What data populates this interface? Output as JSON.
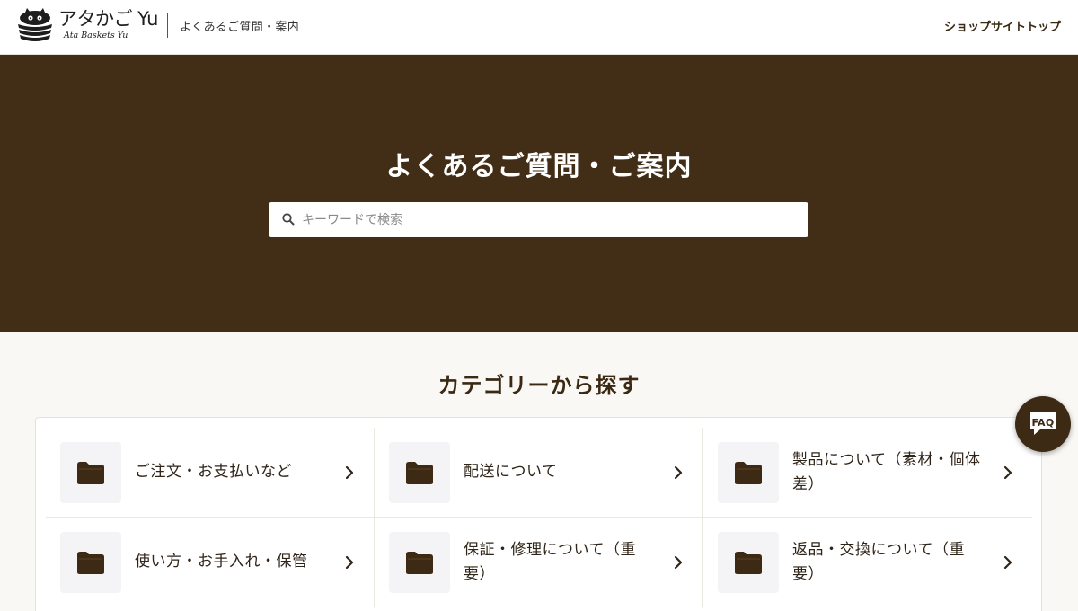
{
  "header": {
    "logo_main": "アタかご Yu",
    "logo_sub": "Ata Baskets Yu",
    "page_title": "よくあるご質問・案内",
    "shop_link": "ショップサイトトップ"
  },
  "hero": {
    "title": "よくあるご質問・ご案内",
    "search_placeholder": "キーワードで検索"
  },
  "categories": {
    "title": "カテゴリーから探す",
    "items": [
      {
        "label": "ご注文・お支払いなど",
        "icon": "folder-icon"
      },
      {
        "label": "配送について",
        "icon": "folder-icon"
      },
      {
        "label": "製品について（素材・個体差）",
        "icon": "folder-icon"
      },
      {
        "label": "使い方・お手入れ・保管",
        "icon": "folder-icon"
      },
      {
        "label": "保証・修理について（重要）",
        "icon": "folder-icon"
      },
      {
        "label": "返品・交換について（重要）",
        "icon": "folder-icon"
      }
    ]
  },
  "faq_button": {
    "label": "FAQ",
    "icon": "chat-bubble-icon"
  },
  "colors": {
    "hero_bg": "#422d16",
    "accent_brown": "#3d2a14",
    "page_bg": "#faf8f5",
    "icon_box_bg": "#f4f4f6"
  }
}
